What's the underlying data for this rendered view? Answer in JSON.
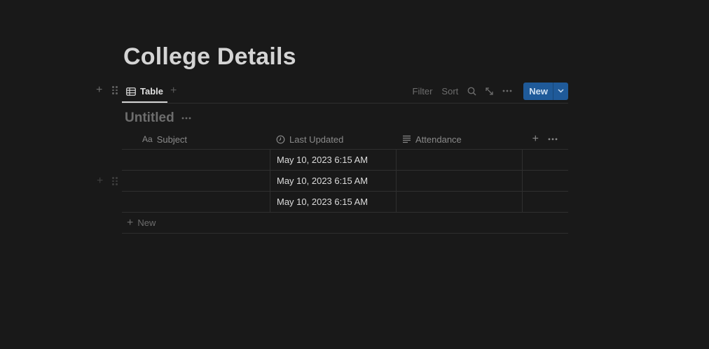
{
  "page": {
    "title": "College Details"
  },
  "tabs": {
    "active_label": "Table"
  },
  "toolbar": {
    "filter_label": "Filter",
    "sort_label": "Sort",
    "new_label": "New"
  },
  "view": {
    "title": "Untitled"
  },
  "table": {
    "columns": [
      {
        "label": "Subject",
        "icon": "text-property-icon",
        "prefix": "Aa"
      },
      {
        "label": "Last Updated",
        "icon": "clock-icon"
      },
      {
        "label": "Attendance",
        "icon": "text-lines-icon"
      }
    ],
    "rows": [
      {
        "subject": "",
        "last_updated": "May 10, 2023 6:15 AM",
        "attendance": ""
      },
      {
        "subject": "",
        "last_updated": "May 10, 2023 6:15 AM",
        "attendance": ""
      },
      {
        "subject": "",
        "last_updated": "May 10, 2023 6:15 AM",
        "attendance": ""
      }
    ],
    "new_row_label": "New"
  },
  "colors": {
    "background": "#191919",
    "accent": "#1f5a99",
    "text": "#d4d4d4",
    "muted": "#6d6d6d"
  }
}
